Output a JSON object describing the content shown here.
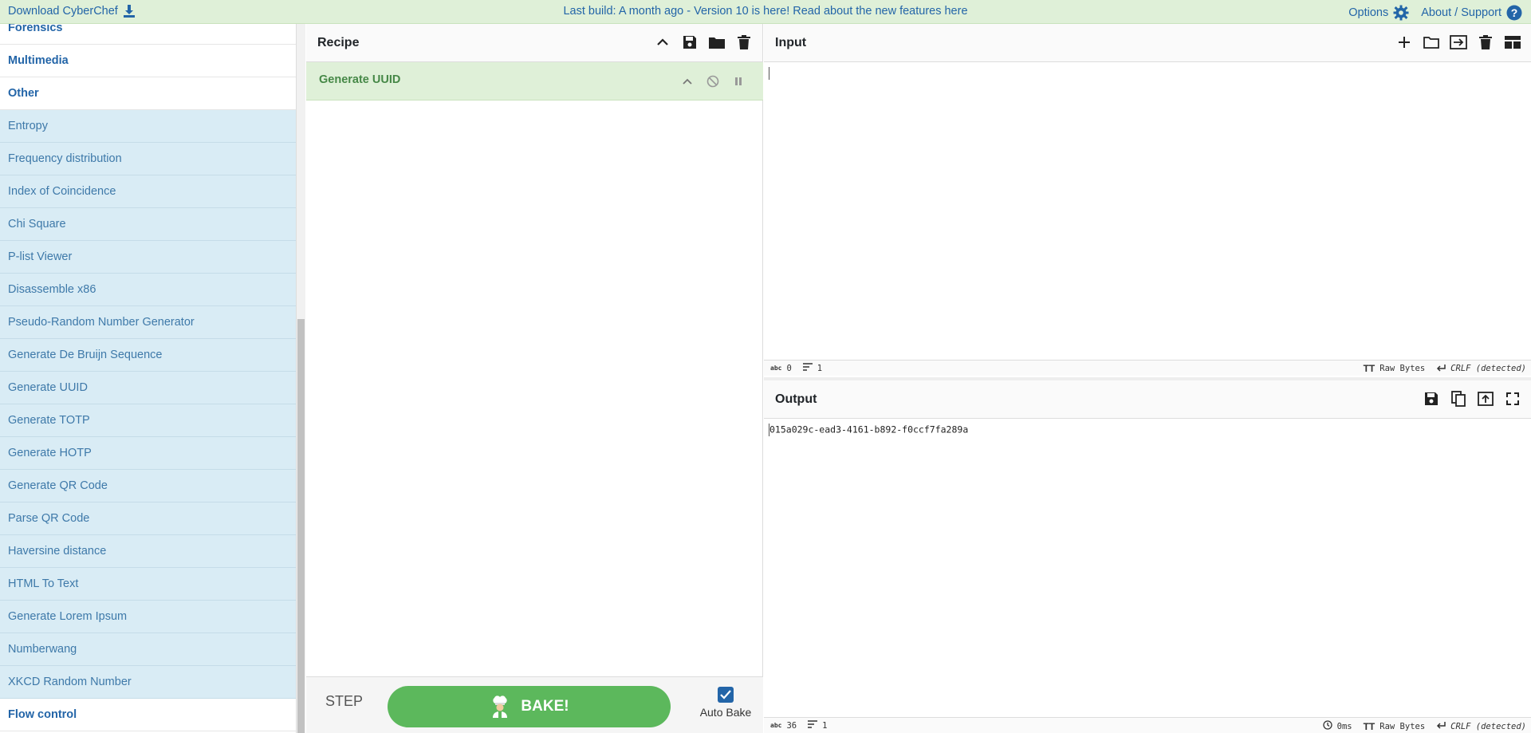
{
  "banner": {
    "download_label": "Download CyberChef",
    "build_message": "Last build: A month ago - Version 10 is here! Read about the new features here",
    "options_label": "Options",
    "about_label": "About / Support"
  },
  "operations": {
    "categories_top": [
      "Forensics",
      "Multimedia",
      "Other"
    ],
    "items": [
      "Entropy",
      "Frequency distribution",
      "Index of Coincidence",
      "Chi Square",
      "P-list Viewer",
      "Disassemble x86",
      "Pseudo-Random Number Generator",
      "Generate De Bruijn Sequence",
      "Generate UUID",
      "Generate TOTP",
      "Generate HOTP",
      "Generate QR Code",
      "Parse QR Code",
      "Haversine distance",
      "HTML To Text",
      "Generate Lorem Ipsum",
      "Numberwang",
      "XKCD Random Number"
    ],
    "category_bottom": "Flow control"
  },
  "recipe": {
    "title": "Recipe",
    "operation": "Generate UUID",
    "step_label": "STEP",
    "bake_label": "BAKE!",
    "autobake_label": "Auto Bake",
    "autobake_checked": true
  },
  "input": {
    "title": "Input",
    "value": "",
    "status": {
      "length": "0",
      "lines": "1",
      "encoding": "Raw Bytes",
      "eol": "CRLF (detected)"
    }
  },
  "output": {
    "title": "Output",
    "value": "015a029c-ead3-4161-b892-f0ccf7fa289a",
    "status": {
      "length": "36",
      "lines": "1",
      "time": "0ms",
      "encoding": "Raw Bytes",
      "eol": "CRLF (detected)"
    }
  },
  "colors": {
    "banner_bg": "#dff0d8",
    "link": "#2365a8",
    "op_bg": "#d9ecf5",
    "bake_green": "#5cb85c",
    "recipe_op_text": "#468847"
  }
}
